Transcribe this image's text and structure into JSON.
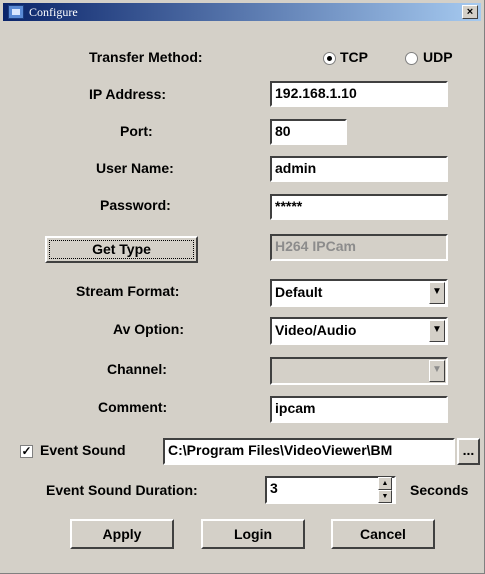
{
  "window": {
    "title": "Configure",
    "close_glyph": "×"
  },
  "transfer": {
    "label": "Transfer Method:",
    "tcp_label": "TCP",
    "udp_label": "UDP",
    "selected": "TCP"
  },
  "ip": {
    "label": "IP Address:",
    "value": "192.168.1.10"
  },
  "port": {
    "label": "Port:",
    "value": "80"
  },
  "user": {
    "label": "User Name:",
    "value": "admin"
  },
  "password": {
    "label": "Password:",
    "value": "*****"
  },
  "get_type": {
    "button_label": "Get Type",
    "value": "H264 IPCam"
  },
  "stream_format": {
    "label": "Stream Format:",
    "value": "Default"
  },
  "av_option": {
    "label": "Av Option:",
    "value": "Video/Audio"
  },
  "channel": {
    "label": "Channel:",
    "value": ""
  },
  "comment": {
    "label": "Comment:",
    "value": "ipcam"
  },
  "event_sound": {
    "label": "Event Sound",
    "checked": true,
    "path": "C:\\Program Files\\VideoViewer\\BM",
    "browse_label": "..."
  },
  "event_duration": {
    "label": "Event Sound Duration:",
    "value": "3",
    "unit": "Seconds"
  },
  "buttons": {
    "apply": "Apply",
    "login": "Login",
    "cancel": "Cancel"
  },
  "icons": {
    "title": "app-icon",
    "dropdown": "chevron-down-icon",
    "spin_up": "spin-up-icon",
    "spin_down": "spin-down-icon"
  }
}
